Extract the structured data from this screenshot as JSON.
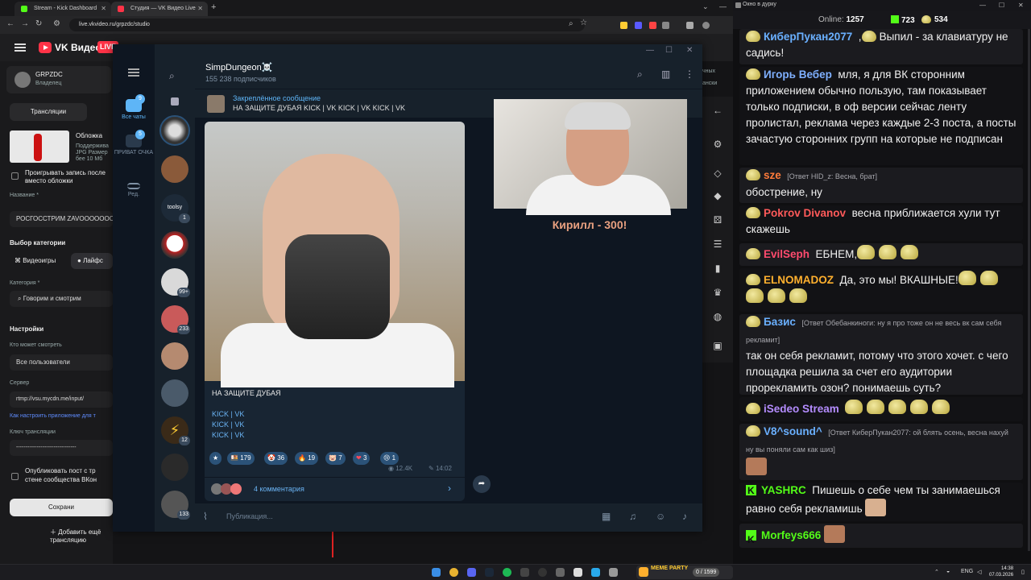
{
  "browser": {
    "tabs": [
      {
        "label": "Stream - Kick Dashboard",
        "color": "#53fc18"
      },
      {
        "label": "Студия — VK Видео Live",
        "color": "#ff3347"
      }
    ],
    "url": "live.vkvideo.ru/grpzdc/studio"
  },
  "vk": {
    "brand": "VK Видео",
    "live_badge": "LIVE",
    "profile": {
      "name": "GRPZDC",
      "role": "Владелец"
    },
    "streams_button": "Трансляции",
    "cover_label": "Обложка",
    "cover_hint_1": "Поддержива",
    "cover_hint_2": "JPG Размер",
    "cover_hint_3": "бее 10 Мб",
    "loop_record_label": "Проигрывать запись после",
    "loop_record_label_2": "вместо обложки",
    "title_label": "Название *",
    "title_value": "РОСГОССТРИМ ZAVOOOOOOO",
    "category_choice_label": "Выбор категории",
    "category_games": "Видеоигры",
    "category_life": "Лайфс",
    "category_label": "Категория *",
    "category_value": "Говорим и смотрим",
    "settings_label": "Настройки",
    "who_can_watch_label": "Кто может смотреть",
    "who_can_watch_value": "Все пользователи",
    "server_label": "Сервер",
    "server_value": "rtmp://vsu.mycdn.me/input/",
    "setup_link": "Как настроить приложение для т",
    "key_label": "Ключ трансляции",
    "key_value": "--------------------------------",
    "publish_label": "Опубликовать пост с тр",
    "publish_label_2": "стене сообщества ВКон",
    "save_button": "Сохрани",
    "add_more_button": "Добавить ещё трансляцию",
    "right_partial": "чных",
    "right_partial_2": "ански"
  },
  "telegram": {
    "folders": [
      {
        "label": "Все чаты",
        "badge": "9"
      },
      {
        "label": "ПРИВАТ ОЧКА",
        "badge": "5"
      },
      {
        "label": "Ред.",
        "badge": ""
      }
    ],
    "chat_badges": [
      "1",
      "99+",
      "233",
      "12",
      "133"
    ],
    "chat_label_tooisy": "toolsy",
    "channel_name": "SimpDungeon☠️",
    "subscribers": "155 238 подписчиков",
    "pinned_title": "Закреплённое сообщение",
    "pinned_text": "НА ЗАЩИТЕ ДУБАЯ  KICK | VK KICK | VK KICK | VK",
    "post_text": "НА ЗАЩИТЕ ДУБАЯ",
    "post_links": [
      "KICK | VK",
      "KICK | VK",
      "KICK | VK"
    ],
    "reactions": [
      {
        "emoji": "★",
        "count": ""
      },
      {
        "emoji": "🍱",
        "count": "179"
      },
      {
        "emoji": "🤡",
        "count": "36"
      },
      {
        "emoji": "🔥",
        "count": "19"
      },
      {
        "emoji": "🐷",
        "count": "7"
      },
      {
        "emoji": "❤",
        "count": "3"
      },
      {
        "emoji": "😢",
        "count": "1"
      }
    ],
    "views": "12.4K",
    "time": "14:02",
    "comments": "4 комментария",
    "video_caption": "Кирилл - 300!",
    "input_placeholder": "Публикация..."
  },
  "chat": {
    "window_title": "Окно в дурку",
    "online_label": "Online:",
    "online_value": "1257",
    "kick_count": "723",
    "vk_count": "534",
    "messages": [
      {
        "user": "КиберПукан2077",
        "color": "#6ab0ff",
        "text": "Выпил - за клавиатуру не садись!",
        "reply": ""
      },
      {
        "user": "Игорь Вебер",
        "color": "#7fb0ff",
        "text": "мля, я для ВК сторонним приложением обычно пользую, там показывает только подписки, в оф версии сейчас ленту пролистал, реклама через каждые 2-3 поста, а посты зачастую сторонних групп на которые не подписан",
        "reply": ""
      },
      {
        "user": "sze",
        "color": "#ff7b3a",
        "text": "обострение, ну",
        "reply": "[Ответ HID_z: Весна, брат]"
      },
      {
        "user": "Pokrov Divanov",
        "color": "#ff5a5a",
        "text": "весна приближается хули тут скажешь",
        "reply": ""
      },
      {
        "user": "EvilSeph",
        "color": "#ff4b6e",
        "text": "ЕБНЕМ",
        "reply": ""
      },
      {
        "user": "ELNOMADOZ",
        "color": "#ffb02e",
        "text": "Да, это мы! ВКАШНЫЕ!",
        "reply": ""
      },
      {
        "user": "Базис",
        "color": "#6ab0ff",
        "text": "так он себя рекламит, потому что этого хочет. с чего площадка решила за счет его аудитории прорекламить озон? понимаешь суть?",
        "reply": "[Ответ Обебанкиноги: ну я про тоже он не весь вк сам себя рекламит]"
      },
      {
        "user": "iSedeo Stream",
        "color": "#b48cff",
        "text": "",
        "reply": ""
      },
      {
        "user": "V8^sound^",
        "color": "#6ab0ff",
        "text": "",
        "reply": "[Ответ КиберПукан2077: ой блять осень, весна нахуй ну вы поняли  сам как шиз]"
      },
      {
        "user": "YASHRC",
        "color": "#53fc18",
        "text": "Пишешь о себе чем ты занимаешься равно себя рекламишь",
        "reply": ""
      },
      {
        "user": "Morfeys666",
        "color": "#53fc18",
        "text": "",
        "reply": ""
      }
    ]
  },
  "taskbar": {
    "meme_label": "MEME PARTY",
    "meme_count": "0 / 1599",
    "lang": "ENG",
    "time": "14:38",
    "date": "07.03.2026"
  }
}
